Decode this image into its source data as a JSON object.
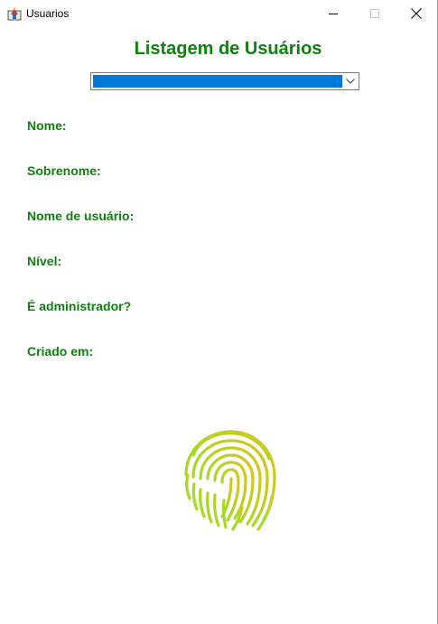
{
  "window": {
    "title": "Usuarios",
    "controls": {
      "minimize": "minimize-icon",
      "maximize": "maximize-icon",
      "close": "close-icon"
    }
  },
  "main": {
    "heading": "Listagem de Usuários",
    "user_select": {
      "selected_value": "",
      "arrow_icon": "chevron-down-icon"
    },
    "fields": {
      "nome": "Nome:",
      "sobrenome": "Sobrenome:",
      "nome_usuario": "Nome de usuário:",
      "nivel": "Nível:",
      "administrador": "É administrador?",
      "criado_em": "Criado em:"
    },
    "image_icon": "fingerprint-icon"
  },
  "colors": {
    "label_green": "#0d820d",
    "selection_blue": "#0078d7",
    "fingerprint_gradient": [
      "#8ee22a",
      "#d9c51f"
    ]
  }
}
